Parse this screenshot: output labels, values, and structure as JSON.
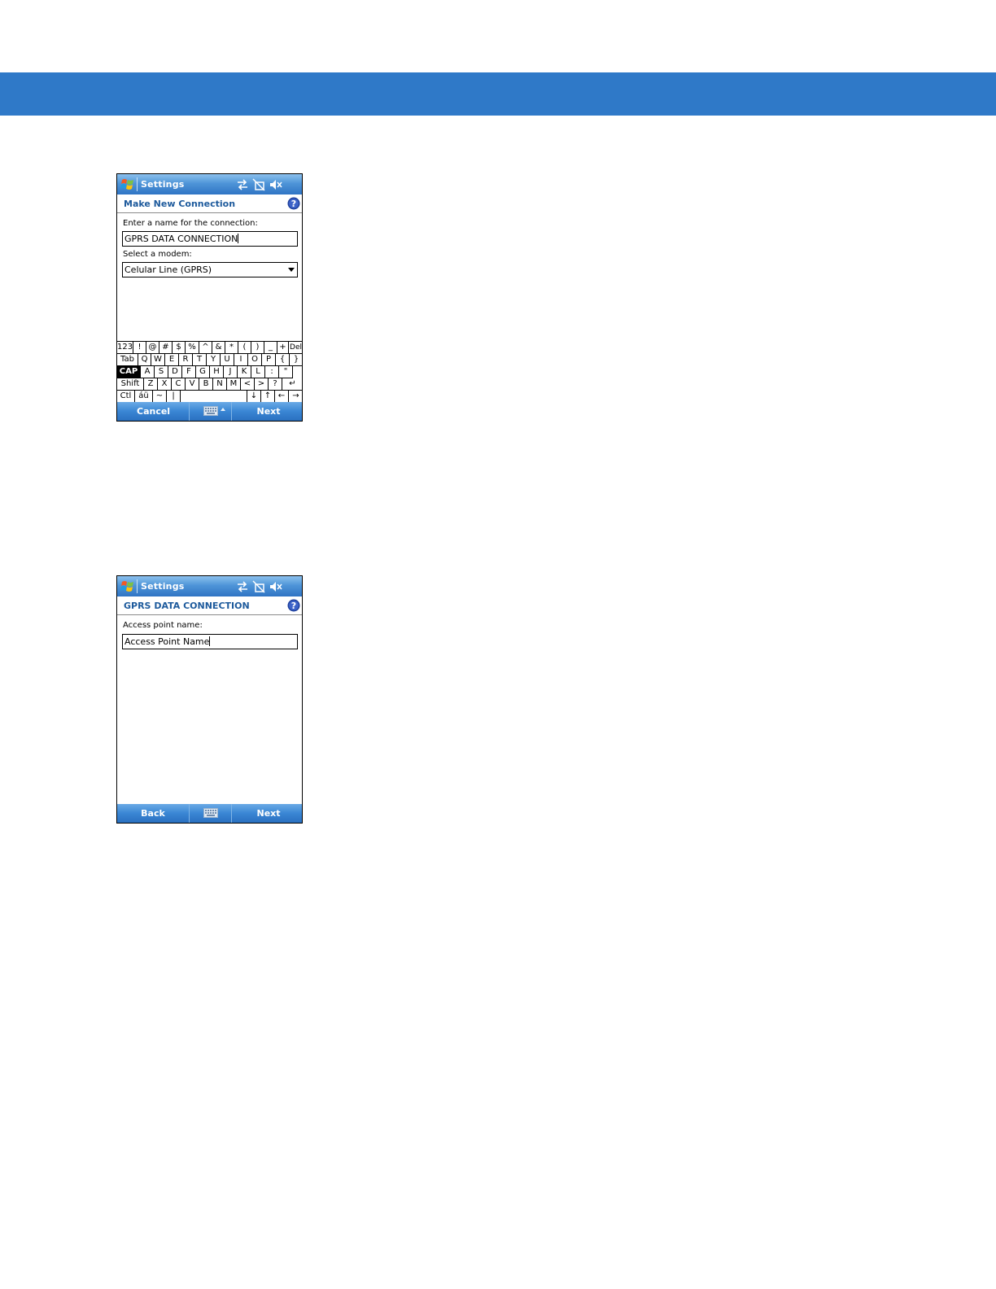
{
  "screen1": {
    "title": "Settings",
    "subheader": "Make New Connection",
    "name_label": "Enter a name for the connection:",
    "name_value": "GPRS DATA CONNECTION",
    "modem_label": "Select a modem:",
    "modem_value": "Celular Line (GPRS)",
    "keyboard": {
      "row1": [
        "123",
        "!",
        "@",
        "#",
        "$",
        "%",
        "^",
        "&",
        "*",
        "(",
        ")",
        "_",
        "+",
        "Del"
      ],
      "row2": [
        "Tab",
        "Q",
        "W",
        "E",
        "R",
        "T",
        "Y",
        "U",
        "I",
        "O",
        "P",
        "{",
        "}"
      ],
      "row3": [
        "CAP",
        "A",
        "S",
        "D",
        "F",
        "G",
        "H",
        "J",
        "K",
        "L",
        ":",
        "\""
      ],
      "row4": [
        "Shift",
        "Z",
        "X",
        "C",
        "V",
        "B",
        "N",
        "M",
        "<",
        ">",
        "?",
        "↵"
      ],
      "row5": [
        "Ctl",
        "áü",
        "~",
        "|",
        "",
        "↓",
        "↑",
        "←",
        "→"
      ]
    },
    "left_softkey": "Cancel",
    "right_softkey": "Next"
  },
  "screen2": {
    "title": "Settings",
    "subheader": "GPRS DATA CONNECTION",
    "apn_label": "Access point name:",
    "apn_value": "Access Point Name",
    "left_softkey": "Back",
    "right_softkey": "Next"
  },
  "colors": {
    "page_band": "#2f79c8",
    "titlebar": "#4f95d8",
    "subheader_text": "#1d5a9c"
  },
  "icons": [
    "windows-start-icon",
    "connectivity-icon",
    "no-phone-icon",
    "speaker-muted-icon",
    "help-icon",
    "keyboard-icon"
  ]
}
